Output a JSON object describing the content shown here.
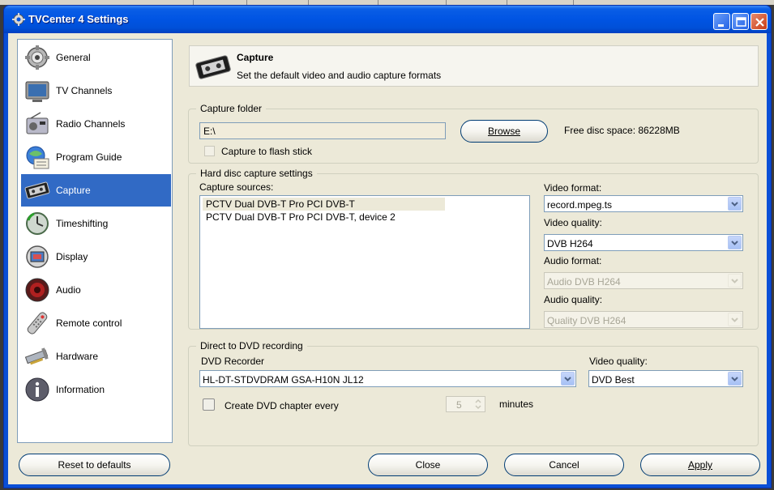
{
  "window": {
    "title": "TVCenter 4 Settings"
  },
  "sidebar": {
    "items": [
      {
        "label": "General",
        "icon": "gear-icon"
      },
      {
        "label": "TV Channels",
        "icon": "tv-icon"
      },
      {
        "label": "Radio Channels",
        "icon": "radio-icon"
      },
      {
        "label": "Program Guide",
        "icon": "program-guide-icon"
      },
      {
        "label": "Capture",
        "icon": "videotape-icon",
        "active": true
      },
      {
        "label": "Timeshifting",
        "icon": "clock-icon"
      },
      {
        "label": "Display",
        "icon": "display-icon"
      },
      {
        "label": "Audio",
        "icon": "speaker-icon"
      },
      {
        "label": "Remote control",
        "icon": "remote-icon"
      },
      {
        "label": "Hardware",
        "icon": "hardware-icon"
      },
      {
        "label": "Information",
        "icon": "info-icon"
      }
    ]
  },
  "header": {
    "title": "Capture",
    "subtitle": "Set the default video and audio capture formats"
  },
  "capture_folder": {
    "legend": "Capture folder",
    "path": "E:\\",
    "browse_label": "Browse",
    "free_space": "Free disc space: 86228MB",
    "flash_label": "Capture to flash stick"
  },
  "hdd": {
    "legend": "Hard disc capture settings",
    "sources_label": "Capture sources:",
    "sources": [
      "PCTV Dual DVB-T Pro PCI DVB-T",
      "PCTV Dual DVB-T Pro PCI DVB-T, device 2"
    ],
    "video_format_label": "Video format:",
    "video_format": "record.mpeg.ts",
    "video_quality_label": "Video quality:",
    "video_quality": "DVB H264",
    "audio_format_label": "Audio format:",
    "audio_format": "Audio DVB H264",
    "audio_quality_label": "Audio quality:",
    "audio_quality": "Quality DVB H264"
  },
  "dvd": {
    "legend": "Direct to DVD recording",
    "recorder_label": "DVD Recorder",
    "recorder": "HL-DT-STDVDRAM GSA-H10N JL12",
    "quality_label": "Video quality:",
    "quality": "DVD Best",
    "chapter_label": "Create DVD chapter every",
    "chapter_value": "5",
    "minutes_label": "minutes"
  },
  "footer": {
    "reset_label": "Reset to defaults",
    "close_label": "Close",
    "cancel_label": "Cancel",
    "apply_label": "Apply"
  },
  "colors": {
    "titlebar": "#0054e3",
    "selection": "#316ac5",
    "dialog_bg": "#ece9d8"
  }
}
